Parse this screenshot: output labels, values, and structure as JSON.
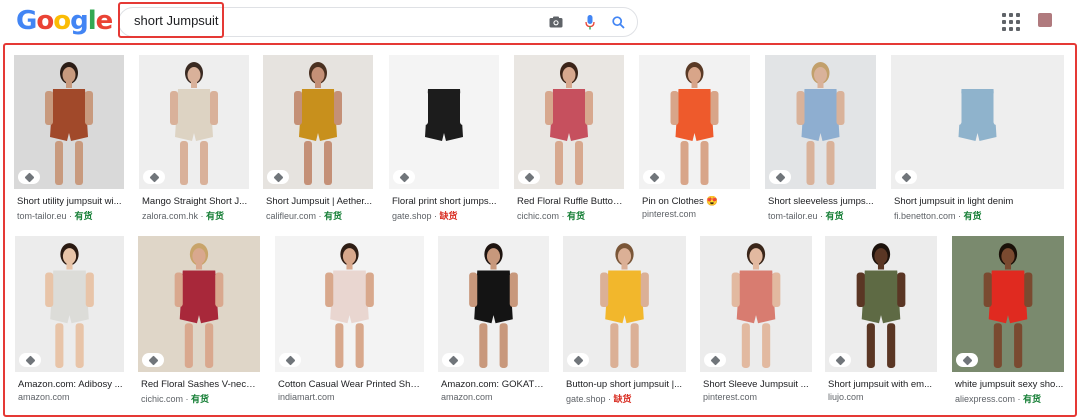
{
  "header": {
    "logo_letters": [
      "G",
      "o",
      "o",
      "g",
      "l",
      "e"
    ],
    "logo_colors": [
      "#4285F4",
      "#EA4335",
      "#FBBC05",
      "#4285F4",
      "#34A853",
      "#EA4335"
    ],
    "search_query": "short Jumpsuit"
  },
  "colors": {
    "accent_red": "#e53935",
    "in_stock_green": "#188038",
    "out_stock_red": "#d93025"
  },
  "results": [
    {
      "title": "Short utility jumpsuit wi...",
      "source": "tom-tailor.eu",
      "stock": "有货",
      "stock_type": "in",
      "bg": "#d9d9d9",
      "outfit": "#a1492a",
      "skin": "#c89a7e",
      "hair": "#2b1d16"
    },
    {
      "title": "Mango Straight Short J...",
      "source": "zalora.com.hk",
      "stock": "有货",
      "stock_type": "in",
      "bg": "#eeeeee",
      "outfit": "#ddd3c3",
      "skin": "#d9b19a",
      "hair": "#3a2a22"
    },
    {
      "title": "Short Jumpsuit | Aether...",
      "source": "califleur.com",
      "stock": "有货",
      "stock_type": "in",
      "bg": "#e6e3df",
      "outfit": "#c8901c",
      "skin": "#c49077",
      "hair": "#4a3020"
    },
    {
      "title": "Floral print short jumps...",
      "source": "gate.shop",
      "stock": "缺货",
      "stock_type": "out",
      "bg": "#f4f4f4",
      "outfit": "#1c1c1c",
      "skin": "#f4f4f4",
      "hair": "#f4f4f4"
    },
    {
      "title": "Red Floral Ruffle Button...",
      "source": "cichic.com",
      "stock": "有货",
      "stock_type": "in",
      "bg": "#e9e6e2",
      "outfit": "#c6505e",
      "skin": "#d7a88e",
      "hair": "#3b2418"
    },
    {
      "title": "Pin on Clothes 😍",
      "source": "pinterest.com",
      "stock": "",
      "stock_type": "none",
      "bg": "#f2f2f2",
      "outfit": "#ee5a2c",
      "skin": "#d8a589",
      "hair": "#5a3a26"
    },
    {
      "title": "Short sleeveless jumps...",
      "source": "tom-tailor.eu",
      "stock": "有货",
      "stock_type": "in",
      "bg": "#e2e4e6",
      "outfit": "#8eaed0",
      "skin": "#d9b29a",
      "hair": "#c2a06c"
    },
    {
      "title": "Short jumpsuit in light denim",
      "source": "fi.benetton.com",
      "stock": "有货",
      "stock_type": "in",
      "bg": "#eeeeee",
      "outfit": "#8fb3cc",
      "skin": "#eeeeee",
      "hair": "#eeeeee"
    },
    {
      "title": "Amazon.com: Adibosy ...",
      "source": "amazon.com",
      "stock": "",
      "stock_type": "none",
      "bg": "#ececec",
      "outfit": "#dcdcd8",
      "skin": "#e8c4a8",
      "hair": "#2a1a12"
    },
    {
      "title": "Red Floral Sashes V-neck ...",
      "source": "cichic.com",
      "stock": "有货",
      "stock_type": "in",
      "bg": "#dfd6c8",
      "outfit": "#a8283a",
      "skin": "#d9a88e",
      "hair": "#c8a46a"
    },
    {
      "title": "Cotton Casual Wear Printed Shor...",
      "source": "indiamart.com",
      "stock": "",
      "stock_type": "none",
      "bg": "#f3f3f3",
      "outfit": "#e9d6d0",
      "skin": "#d8a88c",
      "hair": "#2e1d14"
    },
    {
      "title": "Amazon.com: GOKATO...",
      "source": "amazon.com",
      "stock": "",
      "stock_type": "none",
      "bg": "#f0f0f0",
      "outfit": "#141414",
      "skin": "#c8987c",
      "hair": "#1e1410"
    },
    {
      "title": "Button-up short jumpsuit |...",
      "source": "gate.shop",
      "stock": "缺货",
      "stock_type": "out",
      "bg": "#ededed",
      "outfit": "#f2b72c",
      "skin": "#dbb096",
      "hair": "#7a5638"
    },
    {
      "title": "Short Sleeve Jumpsuit ...",
      "source": "pinterest.com",
      "stock": "",
      "stock_type": "none",
      "bg": "#ececec",
      "outfit": "#d87c70",
      "skin": "#e2b9a0",
      "hair": "#3a261a"
    },
    {
      "title": "Short jumpsuit with em...",
      "source": "liujo.com",
      "stock": "",
      "stock_type": "none",
      "bg": "#ececec",
      "outfit": "#5e6a44",
      "skin": "#5a3624",
      "hair": "#1c120c"
    },
    {
      "title": "white jumpsuit sexy sho...",
      "source": "aliexpress.com",
      "stock": "有货",
      "stock_type": "in",
      "bg": "#7a8a6e",
      "outfit": "#e02a20",
      "skin": "#7a4a30",
      "hair": "#1a1008"
    }
  ]
}
